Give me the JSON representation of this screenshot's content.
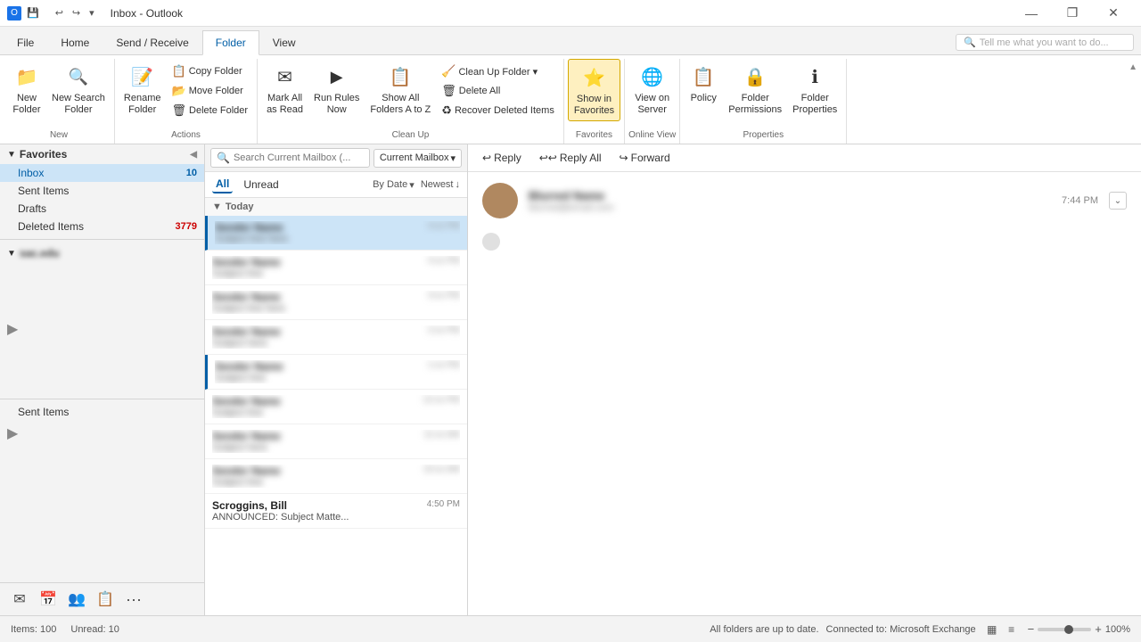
{
  "titleBar": {
    "title": "Inbox - Outlook",
    "saveIcon": "💾",
    "undoIcon": "↩",
    "redoIcon": "↪",
    "customizeIcon": "▾",
    "minimizeBtn": "—",
    "restoreBtn": "❐",
    "closeBtn": "✕"
  },
  "ribbonTabs": {
    "tabs": [
      {
        "id": "file",
        "label": "File"
      },
      {
        "id": "home",
        "label": "Home"
      },
      {
        "id": "send-receive",
        "label": "Send / Receive"
      },
      {
        "id": "folder",
        "label": "Folder",
        "active": true
      },
      {
        "id": "view",
        "label": "View"
      }
    ],
    "searchPlaceholder": "Tell me what you want to do..."
  },
  "ribbon": {
    "groups": [
      {
        "id": "new",
        "label": "New",
        "buttons": [
          {
            "id": "new-folder",
            "icon": "📁",
            "label": "New\nFolder",
            "size": "large"
          },
          {
            "id": "new-search-folder",
            "icon": "🔍",
            "label": "New Search\nFolder",
            "size": "large"
          }
        ]
      },
      {
        "id": "actions",
        "label": "Actions",
        "buttons": [
          {
            "id": "rename-folder",
            "icon": "📝",
            "label": "Rename\nFolder",
            "size": "large"
          },
          {
            "id": "copy-folder",
            "icon": "📋",
            "label": "Copy Folder",
            "size": "small"
          },
          {
            "id": "move-folder",
            "icon": "📂",
            "label": "Move Folder",
            "size": "small"
          },
          {
            "id": "delete-folder",
            "icon": "🗑",
            "label": "Delete Folder",
            "size": "small"
          }
        ]
      },
      {
        "id": "clean-up",
        "label": "Clean Up",
        "buttons": [
          {
            "id": "mark-all-as-read",
            "icon": "✉",
            "label": "Mark All\nas Read",
            "size": "large"
          },
          {
            "id": "run-rules-now",
            "icon": "▶",
            "label": "Run Rules\nNow",
            "size": "large"
          },
          {
            "id": "show-all-folders",
            "icon": "📋",
            "label": "Show All\nFolders A to Z",
            "size": "large"
          },
          {
            "id": "clean-up-folder",
            "icon": "🧹",
            "label": "Clean Up Folder ▾",
            "size": "small"
          },
          {
            "id": "delete-all",
            "icon": "🗑",
            "label": "Delete All",
            "size": "small"
          },
          {
            "id": "recover-deleted",
            "icon": "♻",
            "label": "Recover Deleted Items",
            "size": "small"
          }
        ]
      },
      {
        "id": "favorites",
        "label": "Favorites",
        "buttons": [
          {
            "id": "show-in-favorites",
            "icon": "⭐",
            "label": "Show in\nFavorites",
            "size": "large",
            "active": true
          }
        ]
      },
      {
        "id": "online-view",
        "label": "Online View",
        "buttons": [
          {
            "id": "view-on-server",
            "icon": "🌐",
            "label": "View on\nServer",
            "size": "large"
          }
        ]
      },
      {
        "id": "properties",
        "label": "Properties",
        "buttons": [
          {
            "id": "policy",
            "icon": "📋",
            "label": "Policy",
            "size": "large"
          },
          {
            "id": "folder-permissions",
            "icon": "🔒",
            "label": "Folder\nPermissions",
            "size": "large"
          },
          {
            "id": "folder-properties",
            "icon": "ℹ",
            "label": "Folder\nProperties",
            "size": "large"
          }
        ]
      }
    ]
  },
  "sidebar": {
    "favoritesLabel": "Favorites",
    "collapseIcon": "◀",
    "items": [
      {
        "id": "inbox",
        "label": "Inbox",
        "count": "10",
        "active": true
      },
      {
        "id": "sent-items",
        "label": "Sent Items",
        "count": ""
      },
      {
        "id": "drafts",
        "label": "Drafts",
        "count": ""
      },
      {
        "id": "deleted-items",
        "label": "Deleted Items",
        "count": "3779",
        "countType": "deleted"
      }
    ],
    "accountLabel": "sac.edu",
    "subItems": [
      {
        "id": "sub1",
        "label": ""
      },
      {
        "id": "sub2",
        "label": ""
      },
      {
        "id": "sub3",
        "label": ""
      }
    ],
    "sentItemsBottom": "Sent Items",
    "navButtons": [
      {
        "id": "mail",
        "icon": "✉",
        "label": "Mail"
      },
      {
        "id": "calendar",
        "icon": "📅",
        "label": "Calendar"
      },
      {
        "id": "people",
        "icon": "👥",
        "label": "People"
      },
      {
        "id": "tasks",
        "icon": "📋",
        "label": "Tasks"
      },
      {
        "id": "more",
        "icon": "•••",
        "label": "More"
      }
    ]
  },
  "messageList": {
    "searchPlaceholder": "Search Current Mailbox (...",
    "scopeLabel": "Current Mailbox",
    "filters": [
      {
        "id": "all",
        "label": "All",
        "active": true
      },
      {
        "id": "unread",
        "label": "Unread"
      }
    ],
    "sortLabel": "By Date",
    "orderLabel": "Newest",
    "dateGroup": "Today",
    "messages": [
      {
        "id": "msg1",
        "sender": "",
        "subject": "",
        "time": "",
        "selected": true,
        "unread": true
      },
      {
        "id": "msg2",
        "sender": "",
        "subject": "",
        "time": "",
        "selected": false
      },
      {
        "id": "msg3",
        "sender": "",
        "subject": "",
        "time": "",
        "selected": false
      },
      {
        "id": "msg4",
        "sender": "",
        "subject": "",
        "time": "",
        "selected": false
      },
      {
        "id": "msg5",
        "sender": "",
        "subject": "",
        "time": "",
        "selected": false,
        "unread": true
      },
      {
        "id": "msg6",
        "sender": "",
        "subject": "",
        "time": "",
        "selected": false
      },
      {
        "id": "msg7",
        "sender": "",
        "subject": "",
        "time": "",
        "selected": false
      },
      {
        "id": "msg8",
        "sender": "",
        "subject": "",
        "time": "",
        "selected": false
      },
      {
        "id": "msg9",
        "sender": "Scroggins, Bill",
        "subject": "ANNOUNCED: Subject Matte...",
        "time": "4:50 PM",
        "selected": false
      }
    ]
  },
  "readingPane": {
    "replyLabel": "Reply",
    "replyAllLabel": "Reply All",
    "forwardLabel": "Forward",
    "time": "7:44 PM",
    "senderName": "Sender Name",
    "senderDetail": "sender@domain.com",
    "expandIcon": "⌄"
  },
  "statusBar": {
    "itemsLabel": "Items:",
    "itemsCount": "100",
    "unreadLabel": "Unread:",
    "unreadCount": "10",
    "serverStatus": "All folders are up to date.",
    "connectionLabel": "Connected to: Microsoft Exchange",
    "viewMode1": "▦",
    "viewMode2": "≡",
    "zoomMinus": "−",
    "zoomPlus": "+",
    "zoomLevel": "100%"
  }
}
